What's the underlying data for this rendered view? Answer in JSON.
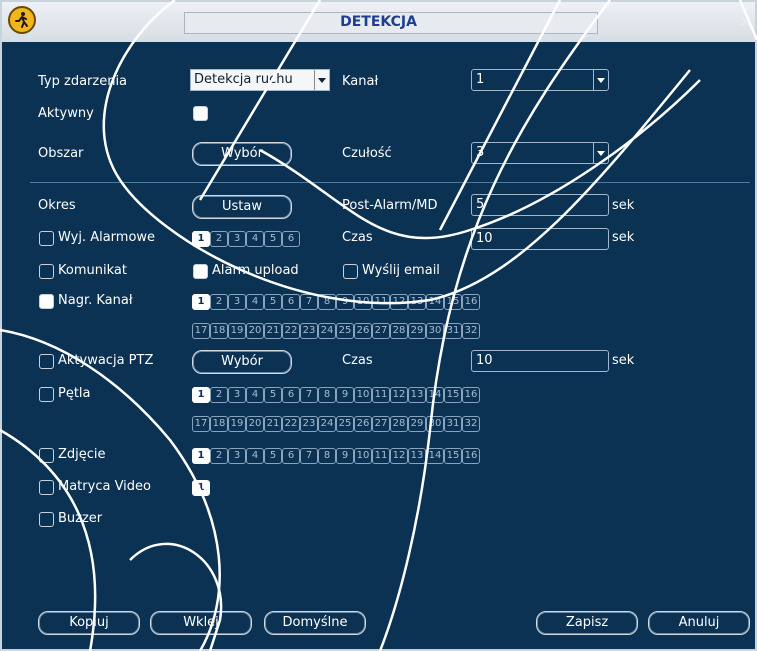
{
  "title": "DETEKCJA",
  "labels": {
    "typ_zdarzenia": "Typ zdarzenia",
    "aktywny": "Aktywny",
    "obszar": "Obszar",
    "kanal": "Kanał",
    "czulosc": "Czułość",
    "okres": "Okres",
    "post_alarm": "Post-Alarm/MD",
    "czas": "Czas",
    "sek": "sek"
  },
  "fields": {
    "typ_zdarzenia_value": "Detekcja ruchu",
    "kanal_value": "1",
    "czulosc_value": "3",
    "post_alarm_value": "5",
    "czas_alarm_value": "10",
    "czas_ptz_value": "10"
  },
  "buttons": {
    "wybor": "Wybór",
    "ustaw": "Ustaw",
    "wybor_ptz": "Wybór",
    "kopiuj": "Kopiuj",
    "wklej": "Wklej",
    "domyslne": "Domyślne",
    "zapisz": "Zapisz",
    "anuluj": "Anuluj"
  },
  "checkboxes": {
    "wyj_alarmowe": "Wyj. Alarmowe",
    "komunikat": "Komunikat",
    "alarm_upload": "Alarm upload",
    "wyslij_email": "Wyślij email",
    "nagr_kanal": "Nagr. Kanał",
    "aktywacja_ptz": "Aktywacja PTZ",
    "petla": "Pętla",
    "zdjecie": "Zdjęcie",
    "matryca_video": "Matryca Video",
    "buzzer": "Buzzer"
  },
  "alarm_outputs": [
    "1",
    "2",
    "3",
    "4",
    "5",
    "6"
  ],
  "channels_row1": [
    "1",
    "2",
    "3",
    "4",
    "5",
    "6",
    "7",
    "8",
    "9",
    "10",
    "11",
    "12",
    "13",
    "14",
    "15",
    "16"
  ],
  "channels_row2": [
    "17",
    "18",
    "19",
    "20",
    "21",
    "22",
    "23",
    "24",
    "25",
    "26",
    "27",
    "28",
    "29",
    "30",
    "31",
    "32"
  ],
  "matryca_channels": [
    "1"
  ],
  "colors": {
    "background": "#0b3153",
    "title_text": "#1e3f8f",
    "selected_box": "#ffffff"
  }
}
